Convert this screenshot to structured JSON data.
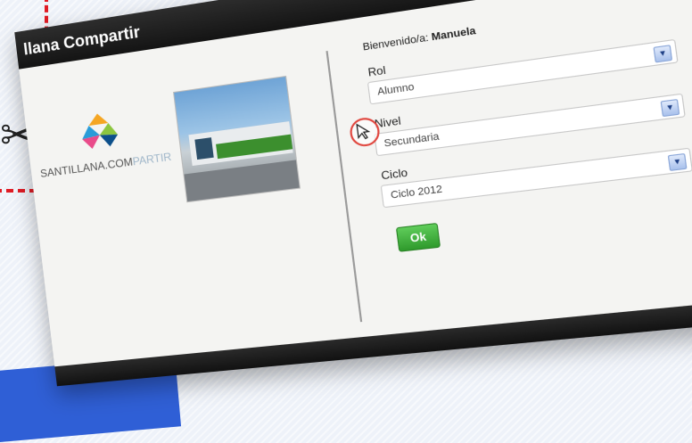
{
  "window": {
    "title": "llana Compartir"
  },
  "logo": {
    "text_main": "SANTILLANA.COM",
    "text_accent": "PARTIR"
  },
  "form": {
    "welcome_prefix": "Bienvenido/a:",
    "welcome_name": "Manuela",
    "rol": {
      "label": "Rol",
      "value": "Alumno"
    },
    "nivel": {
      "label": "Nivel",
      "value": "Secundaria"
    },
    "ciclo": {
      "label": "Ciclo",
      "value": "Ciclo 2012"
    },
    "ok_label": "Ok"
  },
  "icons": {
    "logo": "santillana-logo-icon",
    "dropdown_arrow": "chevron-down-icon",
    "cursor": "cursor-icon",
    "cut": "scissors-icon"
  },
  "colors": {
    "titlebar": "#1f1f1f",
    "ok_button": "#3fae3a",
    "annotation_red": "#e01b24",
    "accent_blue": "#2f5fd6"
  }
}
